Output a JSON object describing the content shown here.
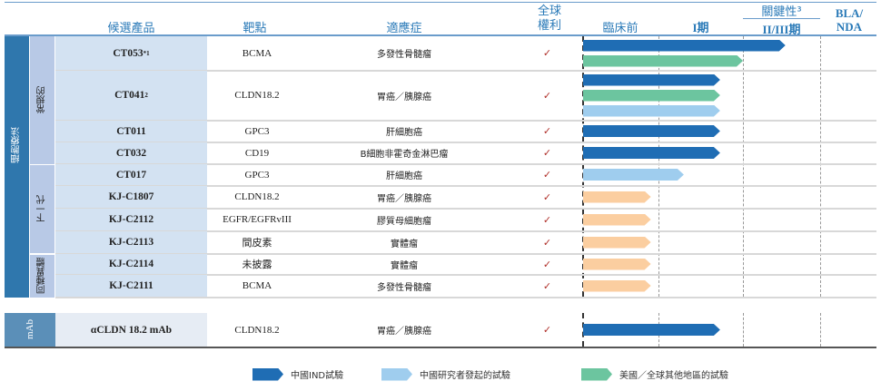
{
  "headers": {
    "product": "候選產品",
    "target": "靶點",
    "indication": "適應症",
    "rights_1": "全球",
    "rights_2": "權利",
    "preclinical": "臨床前",
    "phase1": "I期",
    "pivotal": "關鍵性³",
    "phase23": "II/III期",
    "bla_1": "BLA/",
    "bla_2": "NDA"
  },
  "groups": {
    "cell_therapy": "細胞療法",
    "conventional": "常規的",
    "next_gen": "下一代",
    "allogeneic": "同種異體",
    "mab": "mAb"
  },
  "check": "✓",
  "colors": {
    "china_ind": "#1f6db4",
    "investigator": "#9fcdee",
    "global": "#6cc59f",
    "next_gen": "#fbcea0"
  },
  "rows": [
    {
      "product": "CT053",
      "sup": "*1",
      "target": "BCMA",
      "indication": "多發性骨髓瘤",
      "bars": [
        {
          "type": "china_ind",
          "end": 2.55
        },
        {
          "type": "global",
          "end": 2.0
        }
      ]
    },
    {
      "product": "CT041",
      "sup": "2",
      "target": "CLDN18.2",
      "indication": "胃癌／胰腺癌",
      "bars": [
        {
          "type": "china_ind",
          "end": 1.73
        },
        {
          "type": "global",
          "end": 1.73
        },
        {
          "type": "investigator",
          "end": 1.73
        }
      ]
    },
    {
      "product": "CT011",
      "sup": "",
      "target": "GPC3",
      "indication": "肝細胞癌",
      "bars": [
        {
          "type": "china_ind",
          "end": 1.73
        }
      ]
    },
    {
      "product": "CT032",
      "sup": "",
      "target": "CD19",
      "indication": "B細胞非霍奇金淋巴瘤",
      "bars": [
        {
          "type": "china_ind",
          "end": 1.73
        }
      ]
    },
    {
      "product": "CT017",
      "sup": "",
      "target": "GPC3",
      "indication": "肝細胞癌",
      "bars": [
        {
          "type": "investigator",
          "end": 1.3
        }
      ]
    },
    {
      "product": "KJ-C1807",
      "sup": "",
      "target": "CLDN18.2",
      "indication": "胃癌／胰腺癌",
      "bars": [
        {
          "type": "next_gen",
          "end": 0.9
        }
      ]
    },
    {
      "product": "KJ-C2112",
      "sup": "",
      "target": "EGFR/EGFRvIII",
      "indication": "膠質母細胞瘤",
      "bars": [
        {
          "type": "next_gen",
          "end": 0.9
        }
      ]
    },
    {
      "product": "KJ-C2113",
      "sup": "",
      "target": "間皮素",
      "indication": "實體瘤",
      "bars": [
        {
          "type": "next_gen",
          "end": 0.9
        }
      ]
    },
    {
      "product": "KJ-C2114",
      "sup": "",
      "target": "未披露",
      "indication": "實體瘤",
      "bars": [
        {
          "type": "next_gen",
          "end": 0.9
        }
      ]
    },
    {
      "product": "KJ-C2111",
      "sup": "",
      "target": "BCMA",
      "indication": "多發性骨髓瘤",
      "bars": [
        {
          "type": "next_gen",
          "end": 0.9
        }
      ]
    },
    {
      "product": "αCLDN 18.2 mAb",
      "sup": "",
      "target": "CLDN18.2",
      "indication": "胃癌／胰腺癌",
      "bars": [
        {
          "type": "china_ind",
          "end": 1.73
        }
      ]
    }
  ],
  "legend": [
    {
      "type": "china_ind",
      "label": "中國IND試驗"
    },
    {
      "type": "investigator",
      "label": "中國研究者發起的試驗"
    },
    {
      "type": "global",
      "label": "美國／全球其他地區的試驗"
    }
  ]
}
